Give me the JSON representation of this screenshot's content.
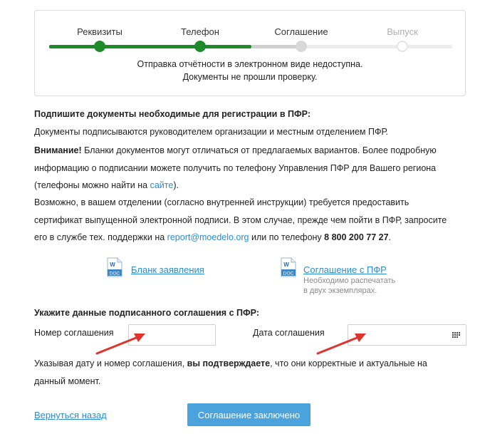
{
  "stepper": {
    "steps": [
      {
        "label": "Реквизиты",
        "state": "done"
      },
      {
        "label": "Телефон",
        "state": "done"
      },
      {
        "label": "Соглашение",
        "state": "current"
      },
      {
        "label": "Выпуск",
        "state": "pending"
      }
    ],
    "status_line1": "Отправка отчётности в электронном виде недоступна.",
    "status_line2": "Документы не прошли проверку.",
    "colors": {
      "done": "#1e8a2a",
      "current": "#d0d0d0",
      "pending": "#ececec"
    }
  },
  "instructions": {
    "heading": "Подпишите документы необходимые для регистрации в ПФР:",
    "line1": "Документы подписываются руководителем организации и местным отделением ПФР.",
    "warning_bold": "Внимание!",
    "warning_text": " Бланки документов могут отличаться от предлагаемых вариантов. Более подробную",
    "line3": "информацию о подписании можете получить по телефону Управления ПФР для Вашего региона",
    "line4_prefix": "(телефоны можно найти на ",
    "line4_link": "сайте",
    "line4_suffix": ").",
    "line5": "Возможно, в вашем отделении (согласно внутренней инструкции) требуется предоставить",
    "line6": "сертификат выпущенной электронной подписи. В этом случае, прежде чем пойти в ПФР, запросите",
    "line7_prefix": "его в службе тех. поддержки на ",
    "line7_email": "report@moedelo.org",
    "line7_middle": " или по телефону ",
    "line7_phone": "8 800 200 77 27",
    "line7_suffix": "."
  },
  "documents": [
    {
      "icon": "word-doc-icon",
      "badge": "DOC",
      "label": "Бланк заявления",
      "note1": "",
      "note2": ""
    },
    {
      "icon": "word-doc-icon",
      "badge": "DOC",
      "label": "Соглашение с ПФР",
      "note1": "Необходимо распечатать",
      "note2": "в двух экземплярах."
    }
  ],
  "agreement_form": {
    "heading": "Укажите данные подписанного соглашения с ПФР:",
    "number_label": "Номер соглашения",
    "number_value": "",
    "date_label": "Дата соглашения",
    "date_value": ""
  },
  "confirmation": {
    "prefix": "Указывая дату и номер соглашения, ",
    "bold": "вы подтверждаете",
    "suffix": ", что они корректные и актуальные на",
    "line2": "данный момент."
  },
  "actions": {
    "back_label": "Вернуться назад",
    "submit_label": "Соглашение заключено"
  },
  "accent_color": "#2a8cd0",
  "annotation_color": "#e0332b"
}
